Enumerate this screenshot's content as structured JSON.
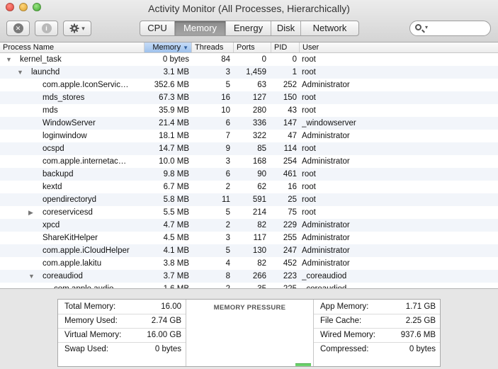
{
  "window": {
    "title": "Activity Monitor (All Processes, Hierarchically)"
  },
  "toolbar": {
    "stop_icon": "x-circle-icon",
    "info_icon": "info-circle-icon",
    "gear_icon": "gear-icon",
    "gear_caret": "▾",
    "tabs": [
      {
        "label": "CPU",
        "active": false
      },
      {
        "label": "Memory",
        "active": true
      },
      {
        "label": "Energy",
        "active": false
      },
      {
        "label": "Disk",
        "active": false
      },
      {
        "label": "Network",
        "active": false
      }
    ],
    "search_placeholder": ""
  },
  "table": {
    "columns": [
      "Process Name",
      "Memory",
      "Threads",
      "Ports",
      "PID",
      "User"
    ],
    "sort_indicator": "▼",
    "rows": [
      {
        "name": "kernel_task",
        "memory": "0 bytes",
        "threads": "84",
        "ports": "0",
        "pid": "0",
        "user": "root",
        "level": 0,
        "disclosure": "open"
      },
      {
        "name": "launchd",
        "memory": "3.1 MB",
        "threads": "3",
        "ports": "1,459",
        "pid": "1",
        "user": "root",
        "level": 1,
        "disclosure": "open"
      },
      {
        "name": "com.apple.IconServic…",
        "memory": "352.6 MB",
        "threads": "5",
        "ports": "63",
        "pid": "252",
        "user": "Administrator",
        "level": 2,
        "disclosure": ""
      },
      {
        "name": "mds_stores",
        "memory": "67.3 MB",
        "threads": "16",
        "ports": "127",
        "pid": "150",
        "user": "root",
        "level": 2,
        "disclosure": ""
      },
      {
        "name": "mds",
        "memory": "35.9 MB",
        "threads": "10",
        "ports": "280",
        "pid": "43",
        "user": "root",
        "level": 2,
        "disclosure": ""
      },
      {
        "name": "WindowServer",
        "memory": "21.4 MB",
        "threads": "6",
        "ports": "336",
        "pid": "147",
        "user": "_windowserver",
        "level": 2,
        "disclosure": ""
      },
      {
        "name": "loginwindow",
        "memory": "18.1 MB",
        "threads": "7",
        "ports": "322",
        "pid": "47",
        "user": "Administrator",
        "level": 2,
        "disclosure": ""
      },
      {
        "name": "ocspd",
        "memory": "14.7 MB",
        "threads": "9",
        "ports": "85",
        "pid": "114",
        "user": "root",
        "level": 2,
        "disclosure": ""
      },
      {
        "name": "com.apple.internetac…",
        "memory": "10.0 MB",
        "threads": "3",
        "ports": "168",
        "pid": "254",
        "user": "Administrator",
        "level": 2,
        "disclosure": ""
      },
      {
        "name": "backupd",
        "memory": "9.8 MB",
        "threads": "6",
        "ports": "90",
        "pid": "461",
        "user": "root",
        "level": 2,
        "disclosure": ""
      },
      {
        "name": "kextd",
        "memory": "6.7 MB",
        "threads": "2",
        "ports": "62",
        "pid": "16",
        "user": "root",
        "level": 2,
        "disclosure": ""
      },
      {
        "name": "opendirectoryd",
        "memory": "5.8 MB",
        "threads": "11",
        "ports": "591",
        "pid": "25",
        "user": "root",
        "level": 2,
        "disclosure": ""
      },
      {
        "name": "coreservicesd",
        "memory": "5.5 MB",
        "threads": "5",
        "ports": "214",
        "pid": "75",
        "user": "root",
        "level": 2,
        "disclosure": "closed"
      },
      {
        "name": "xpcd",
        "memory": "4.7 MB",
        "threads": "2",
        "ports": "82",
        "pid": "229",
        "user": "Administrator",
        "level": 2,
        "disclosure": ""
      },
      {
        "name": "ShareKitHelper",
        "memory": "4.5 MB",
        "threads": "3",
        "ports": "117",
        "pid": "255",
        "user": "Administrator",
        "level": 2,
        "disclosure": ""
      },
      {
        "name": "com.apple.iCloudHelper",
        "memory": "4.1 MB",
        "threads": "5",
        "ports": "130",
        "pid": "247",
        "user": "Administrator",
        "level": 2,
        "disclosure": ""
      },
      {
        "name": "com.apple.lakitu",
        "memory": "3.8 MB",
        "threads": "4",
        "ports": "82",
        "pid": "452",
        "user": "Administrator",
        "level": 2,
        "disclosure": ""
      },
      {
        "name": "coreaudiod",
        "memory": "3.7 MB",
        "threads": "8",
        "ports": "266",
        "pid": "223",
        "user": "_coreaudiod",
        "level": 2,
        "disclosure": "open"
      },
      {
        "name": "com.apple.audio.…",
        "memory": "1.6 MB",
        "threads": "2",
        "ports": "35",
        "pid": "225",
        "user": "_coreaudiod",
        "level": 3,
        "disclosure": ""
      }
    ]
  },
  "stats": {
    "left": [
      {
        "label": "Total Memory:",
        "value": "16.00"
      },
      {
        "label": "Memory Used:",
        "value": "2.74 GB"
      },
      {
        "label": "Virtual Memory:",
        "value": "16.00 GB"
      },
      {
        "label": "Swap Used:",
        "value": "0 bytes"
      }
    ],
    "pressure_title": "MEMORY PRESSURE",
    "right": [
      {
        "label": "App Memory:",
        "value": "1.71 GB"
      },
      {
        "label": "File Cache:",
        "value": "2.25 GB"
      },
      {
        "label": "Wired Memory:",
        "value": "937.6 MB"
      },
      {
        "label": "Compressed:",
        "value": "0 bytes"
      }
    ]
  }
}
